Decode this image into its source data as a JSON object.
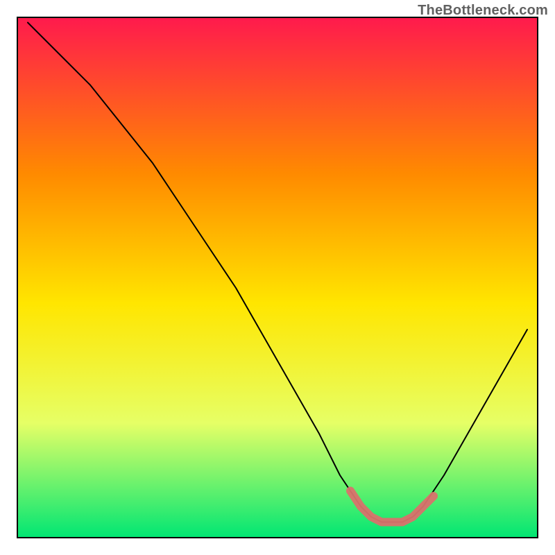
{
  "watermark": "TheBottleneck.com",
  "chart_data": {
    "type": "line",
    "title": "",
    "xlabel": "",
    "ylabel": "",
    "xlim": [
      0,
      100
    ],
    "ylim": [
      0,
      100
    ],
    "series": [
      {
        "name": "bottleneck-curve",
        "x": [
          2,
          6,
          10,
          14,
          18,
          22,
          26,
          30,
          34,
          38,
          42,
          46,
          50,
          54,
          58,
          62,
          64,
          66,
          68,
          70,
          72,
          74,
          76,
          78,
          82,
          86,
          90,
          94,
          98
        ],
        "y": [
          99,
          95,
          91,
          87,
          82,
          77,
          72,
          66,
          60,
          54,
          48,
          41,
          34,
          27,
          20,
          12,
          9,
          6,
          4,
          3,
          3,
          3,
          4,
          6,
          12,
          19,
          26,
          33,
          40
        ]
      }
    ],
    "highlight_segment": {
      "name": "optimal-range",
      "x": [
        64,
        66,
        68,
        70,
        72,
        74,
        76,
        78,
        80
      ],
      "y": [
        9,
        6,
        4,
        3,
        3,
        3,
        4,
        6,
        8
      ]
    },
    "background_gradient": {
      "top": "#ff1a4d",
      "mid_upper": "#ff8a00",
      "mid": "#ffe600",
      "mid_lower": "#e6ff66",
      "bottom": "#00e673"
    }
  }
}
